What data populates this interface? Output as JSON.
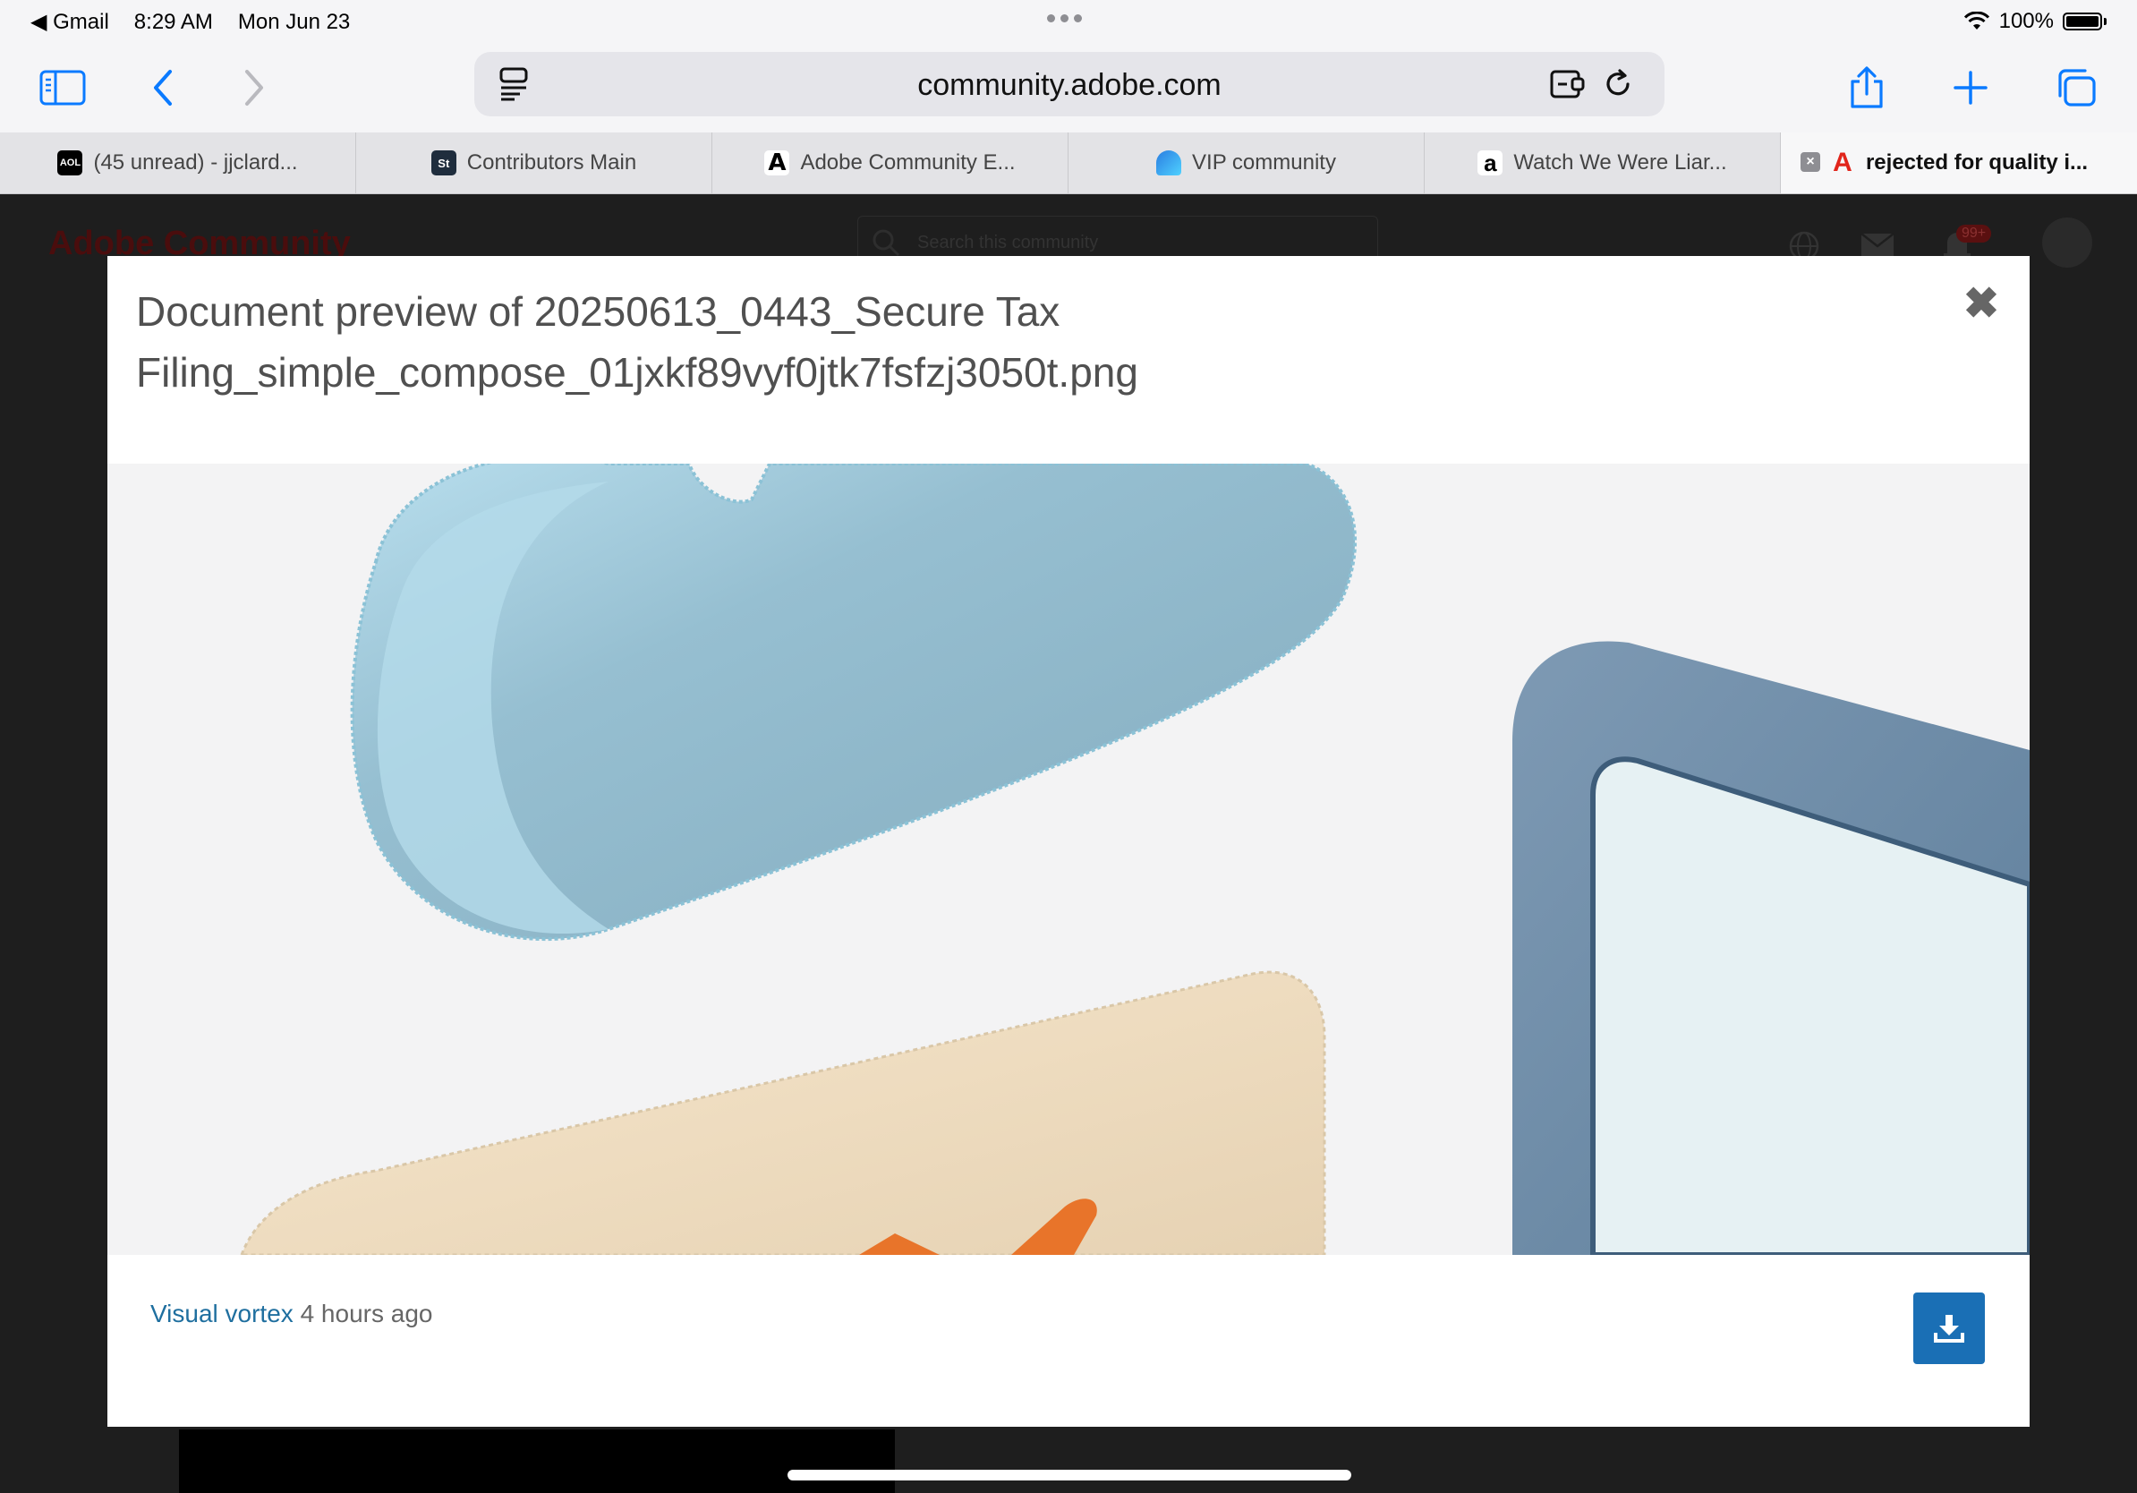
{
  "status_bar": {
    "back_app": "◀ Gmail",
    "time": "8:29 AM",
    "date": "Mon Jun 23",
    "battery": "100%"
  },
  "toolbar": {
    "url": "community.adobe.com"
  },
  "tabs": [
    {
      "favicon": "AOL",
      "label": "(45 unread) - jjclard..."
    },
    {
      "favicon": "St",
      "label": "Contributors Main"
    },
    {
      "favicon": "A",
      "label": "Adobe Community E..."
    },
    {
      "favicon": "V",
      "label": "VIP community"
    },
    {
      "favicon": "a",
      "label": "Watch We Were Liar..."
    },
    {
      "favicon": "A",
      "label": "rejected for quality i..."
    }
  ],
  "background_page": {
    "logo": "Adobe Community",
    "search_placeholder": "Search this community",
    "notification_count": "99+"
  },
  "modal": {
    "title": "Document preview of 20250613_0443_Secure Tax Filing_simple_compose_01jxkf89vyf0jtk7fsfzj3050t.png",
    "author": "Visual vortex",
    "time_ago": "4 hours ago"
  },
  "colors": {
    "accent": "#0a7aff",
    "download_button": "#1a6fb5",
    "author_link": "#1f6f9f"
  }
}
